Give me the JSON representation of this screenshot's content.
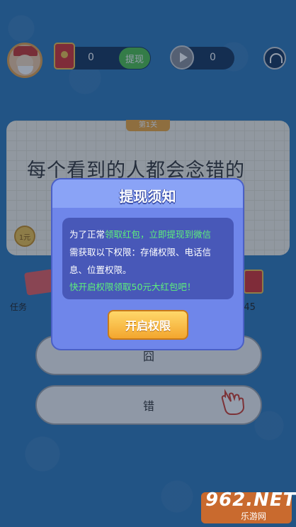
{
  "header": {
    "money_value": "0",
    "withdraw_label": "提现",
    "video_value": "0"
  },
  "card": {
    "level_tag": "第1关",
    "question": "每个看到的人都会念错的",
    "coin_label": "1元"
  },
  "side": {
    "task_label": "任务",
    "timer": ":45"
  },
  "answers": [
    {
      "label": "囧"
    },
    {
      "label": "错"
    }
  ],
  "modal": {
    "title": "提现须知",
    "line1_prefix": "为了正常",
    "line1_highlight": "领取红包，立即提现到微信",
    "line2": "需获取以下权限：存储权限、电话信",
    "line3": "息、位置权限。",
    "line4": "快开启权限领取50元大红包吧！",
    "button_label": "开启权限"
  },
  "watermark": {
    "main": "962.NET",
    "sub": "乐游网"
  },
  "colors": {
    "background": "#2f78b8",
    "modal": "#6f86ea",
    "modal_body": "#4858b8",
    "highlight_green": "#5ef07a",
    "button_orange": "#f3a62e"
  }
}
